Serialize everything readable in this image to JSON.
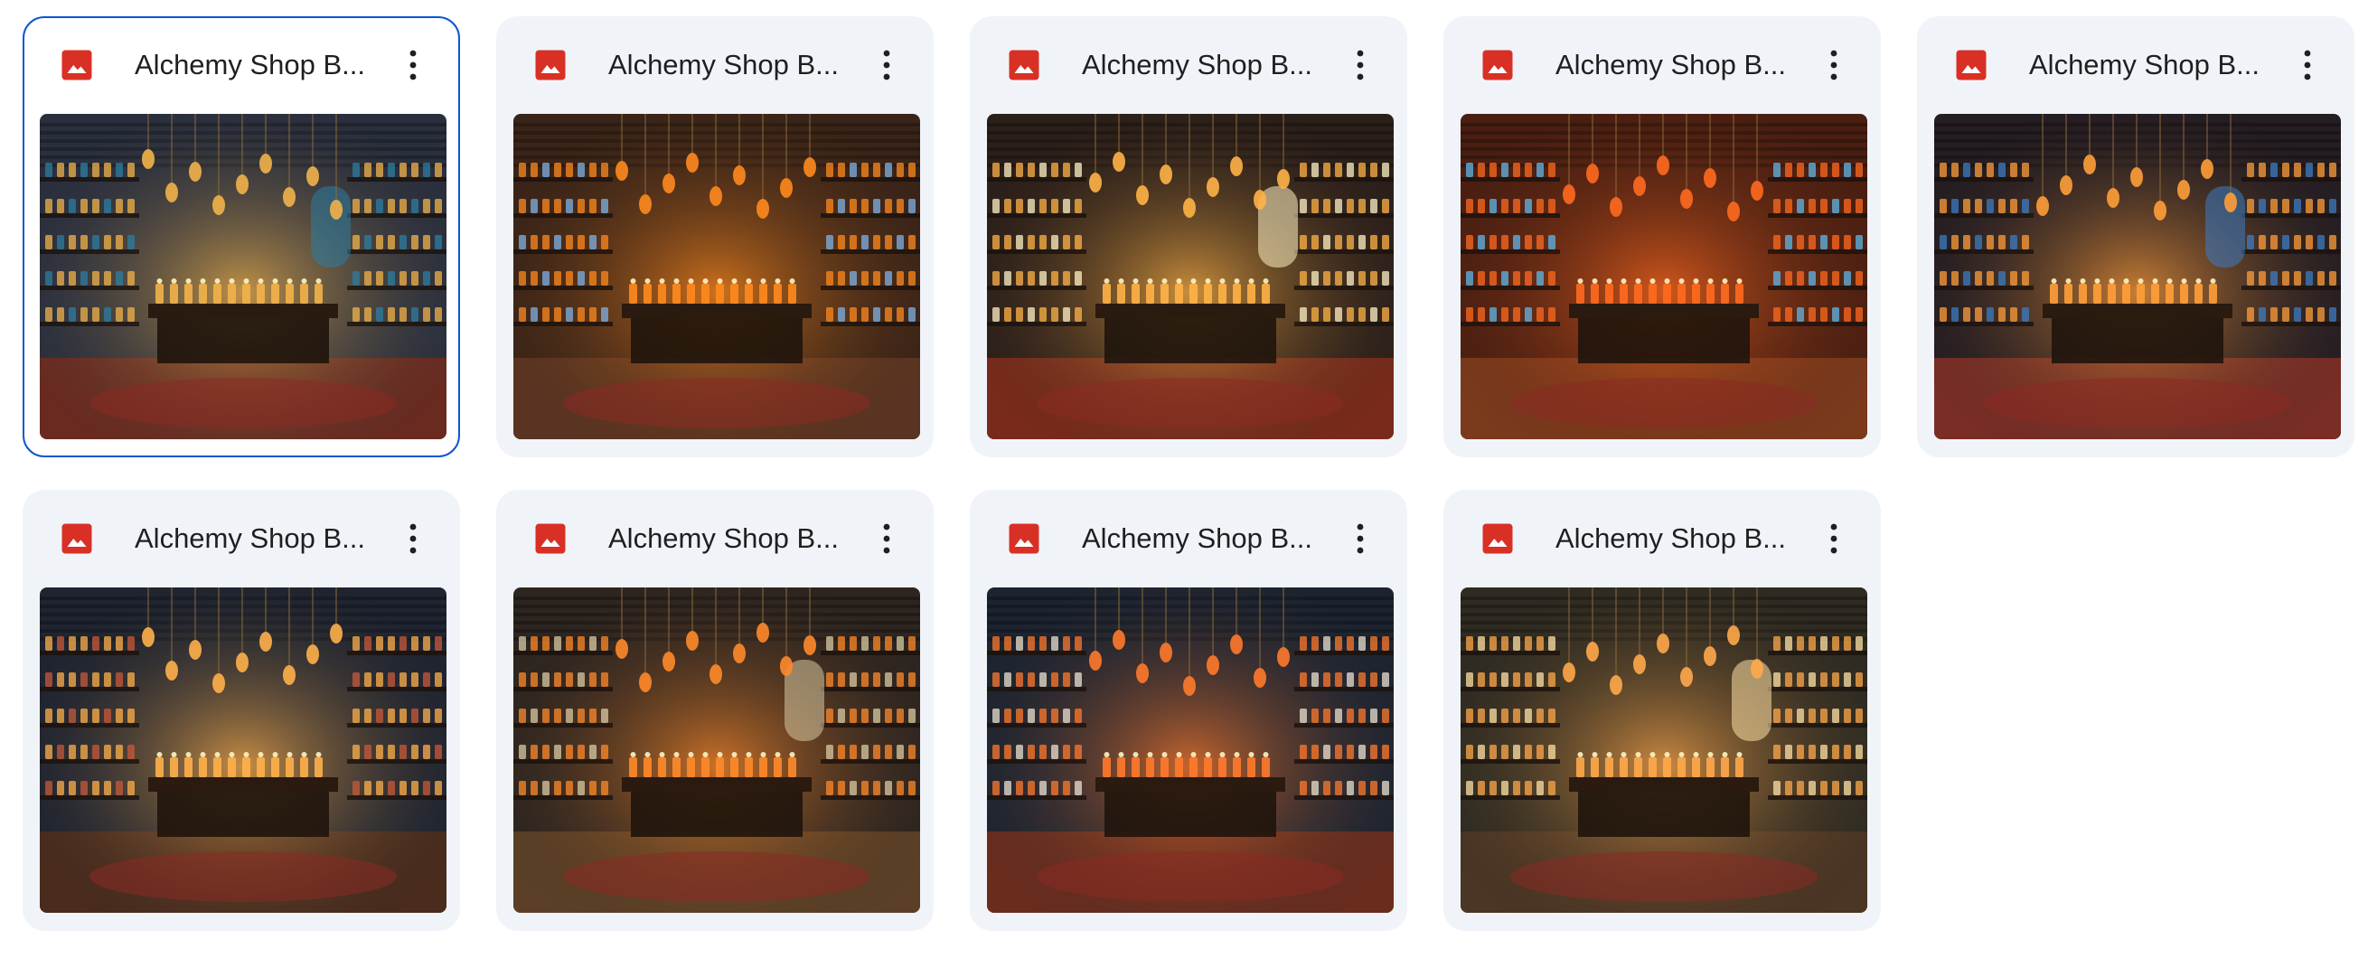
{
  "files": [
    {
      "name": "Alchemy Shop B...",
      "selected": true,
      "palette": {
        "wall": "#2a2f3d",
        "glow": "#f2b34a",
        "floor": "#6b2a1f",
        "accent": "#2c7ea3"
      }
    },
    {
      "name": "Alchemy Shop B...",
      "selected": false,
      "palette": {
        "wall": "#3a2418",
        "glow": "#ff8a1e",
        "floor": "#5a3422",
        "accent": "#7fb2e6"
      }
    },
    {
      "name": "Alchemy Shop B...",
      "selected": false,
      "palette": {
        "wall": "#2b1f1a",
        "glow": "#ffb347",
        "floor": "#7a2a1c",
        "accent": "#fff2c4"
      }
    },
    {
      "name": "Alchemy Shop B...",
      "selected": false,
      "palette": {
        "wall": "#4a1f12",
        "glow": "#ff6a1f",
        "floor": "#7b3a1c",
        "accent": "#5fb7e8"
      }
    },
    {
      "name": "Alchemy Shop B...",
      "selected": false,
      "palette": {
        "wall": "#241d22",
        "glow": "#ff9e3a",
        "floor": "#7a2d25",
        "accent": "#3c7cc2"
      }
    },
    {
      "name": "Alchemy Shop B...",
      "selected": false,
      "palette": {
        "wall": "#1f2430",
        "glow": "#ffb04a",
        "floor": "#4a2b1c",
        "accent": "#c85a3a"
      }
    },
    {
      "name": "Alchemy Shop B...",
      "selected": false,
      "palette": {
        "wall": "#2d2520",
        "glow": "#ff8a2a",
        "floor": "#5b4027",
        "accent": "#d9c9a3"
      }
    },
    {
      "name": "Alchemy Shop B...",
      "selected": false,
      "palette": {
        "wall": "#1d2430",
        "glow": "#ff7a2c",
        "floor": "#6a2c1d",
        "accent": "#e9e2d0"
      }
    },
    {
      "name": "Alchemy Shop B...",
      "selected": false,
      "palette": {
        "wall": "#2f2b22",
        "glow": "#ffa84a",
        "floor": "#4b3524",
        "accent": "#ffe2a6"
      }
    }
  ],
  "icons": {
    "file_type": "image-file-icon",
    "more": "more-vertical-icon"
  },
  "colors": {
    "card_bg": "#f0f4f9",
    "selected_border": "#0b57d0",
    "image_icon": "#d93025"
  }
}
